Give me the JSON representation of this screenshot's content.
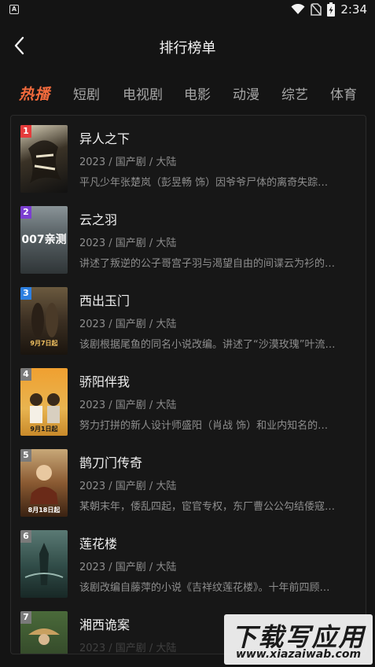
{
  "status_bar": {
    "time": "2:34",
    "app_icon": "A"
  },
  "header": {
    "title": "排行榜单"
  },
  "tabs": [
    "热播",
    "短剧",
    "电视剧",
    "电影",
    "动漫",
    "综艺",
    "体育"
  ],
  "list": [
    {
      "rank": "1",
      "title": "异人之下",
      "meta": "2023 / 国产剧 / 大陆",
      "desc": "平凡少年张楚岚（彭昱畅 饰）因爷爷尸体的离奇失踪…",
      "poster_text": "",
      "rank_color": "#e53b3b"
    },
    {
      "rank": "2",
      "title": "云之羽",
      "meta": "2023 / 国产剧 / 大陆",
      "desc": "讲述了叛逆的公子哥宫子羽与渴望自由的间谍云为衫的…",
      "poster_text": "007亲测",
      "rank_color": "#7b3fd0"
    },
    {
      "rank": "3",
      "title": "西出玉门",
      "meta": "2023 / 国产剧 / 大陆",
      "desc": "该剧根据尾鱼的同名小说改编。讲述了“沙漠玫瑰”叶流…",
      "poster_text": "9月7日起",
      "rank_color": "#2d7fe0"
    },
    {
      "rank": "4",
      "title": "骄阳伴我",
      "meta": "2023 / 国产剧 / 大陆",
      "desc": "努力打拼的新人设计师盛阳（肖战 饰）和业内知名的…",
      "poster_text": "9月1日起",
      "rank_color": "#7a7a7a"
    },
    {
      "rank": "5",
      "title": "鹊刀门传奇",
      "meta": "2023 / 国产剧 / 大陆",
      "desc": "某朝末年，倭乱四起，宦官专权，东厂曹公公勾结倭寇…",
      "poster_text": "8月18日起",
      "rank_color": "#7a7a7a"
    },
    {
      "rank": "6",
      "title": "莲花楼",
      "meta": "2023 / 国产剧 / 大陆",
      "desc": "该剧改编自藤萍的小说《吉祥纹莲花楼》。十年前四顾…",
      "poster_text": "",
      "rank_color": "#7a7a7a"
    },
    {
      "rank": "7",
      "title": "湘西诡案",
      "meta": "2023 / 国产剧 / 大陆",
      "desc": "",
      "poster_text": "",
      "rank_color": "#7a7a7a"
    }
  ],
  "watermark": {
    "main": "下载写应用",
    "url": "www.xiazaiwab.com"
  }
}
